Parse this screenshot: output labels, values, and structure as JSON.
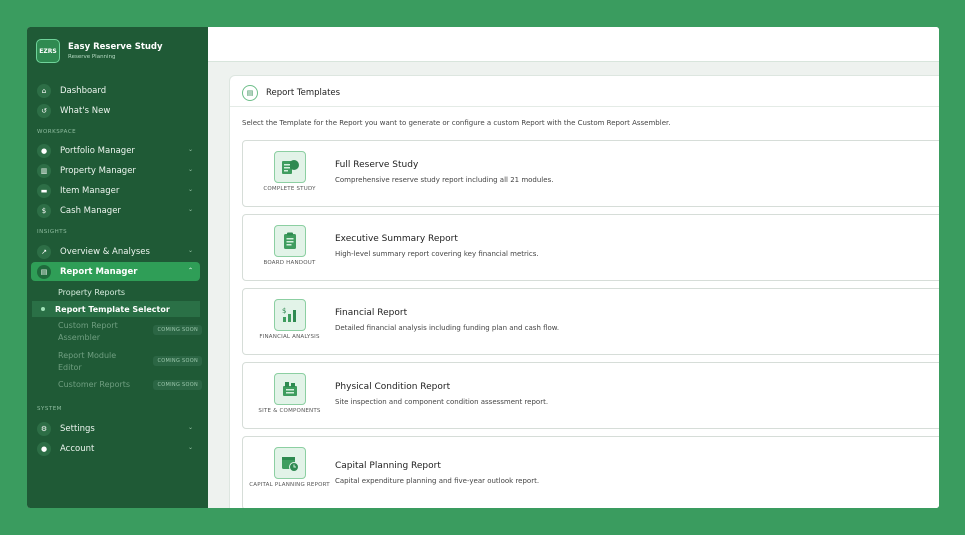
{
  "brand": {
    "logo": "EZRS",
    "name": "Easy Reserve Study",
    "tagline": "Reserve Planning"
  },
  "nav": {
    "dashboard": "Dashboard",
    "whats_new": "What's New",
    "section_workspace": "WORKSPACE",
    "portfolio": "Portfolio Manager",
    "property": "Property Manager",
    "item": "Item Manager",
    "cash": "Cash Manager",
    "section_insights": "INSIGHTS",
    "overview": "Overview & Analyses",
    "report_manager": "Report Manager",
    "sub": {
      "property_reports": "Property Reports",
      "template_selector": "Report Template Selector",
      "custom_assembler": "Custom Report Assembler",
      "module_editor": "Report Module Editor",
      "customer_reports": "Customer Reports",
      "coming_soon": "COMING SOON"
    },
    "section_system": "SYSTEM",
    "settings": "Settings",
    "account": "Account"
  },
  "panel": {
    "title": "Report Templates",
    "description": "Select the Template for the Report you want to generate or configure a custom Report with the Custom Report Assembler."
  },
  "cards": [
    {
      "label": "COMPLETE STUDY",
      "title": "Full Reserve Study",
      "desc": "Comprehensive reserve study report including all 21 modules."
    },
    {
      "label": "BOARD HANDOUT",
      "title": "Executive Summary Report",
      "desc": "High-level summary report covering key financial metrics."
    },
    {
      "label": "FINANCIAL ANALYSIS",
      "title": "Financial Report",
      "desc": "Detailed financial analysis including funding plan and cash flow."
    },
    {
      "label": "SITE & COMPONENTS",
      "title": "Physical Condition Report",
      "desc": "Site inspection and component condition assessment report."
    },
    {
      "label": "CAPITAL PLANNING REPORT",
      "title": "Capital Planning Report",
      "desc": "Capital expenditure planning and five-year outlook report."
    }
  ],
  "colors": {
    "accent": "#2f9e57",
    "sidebar": "#1f5a36",
    "frame": "#3a9c5f"
  }
}
